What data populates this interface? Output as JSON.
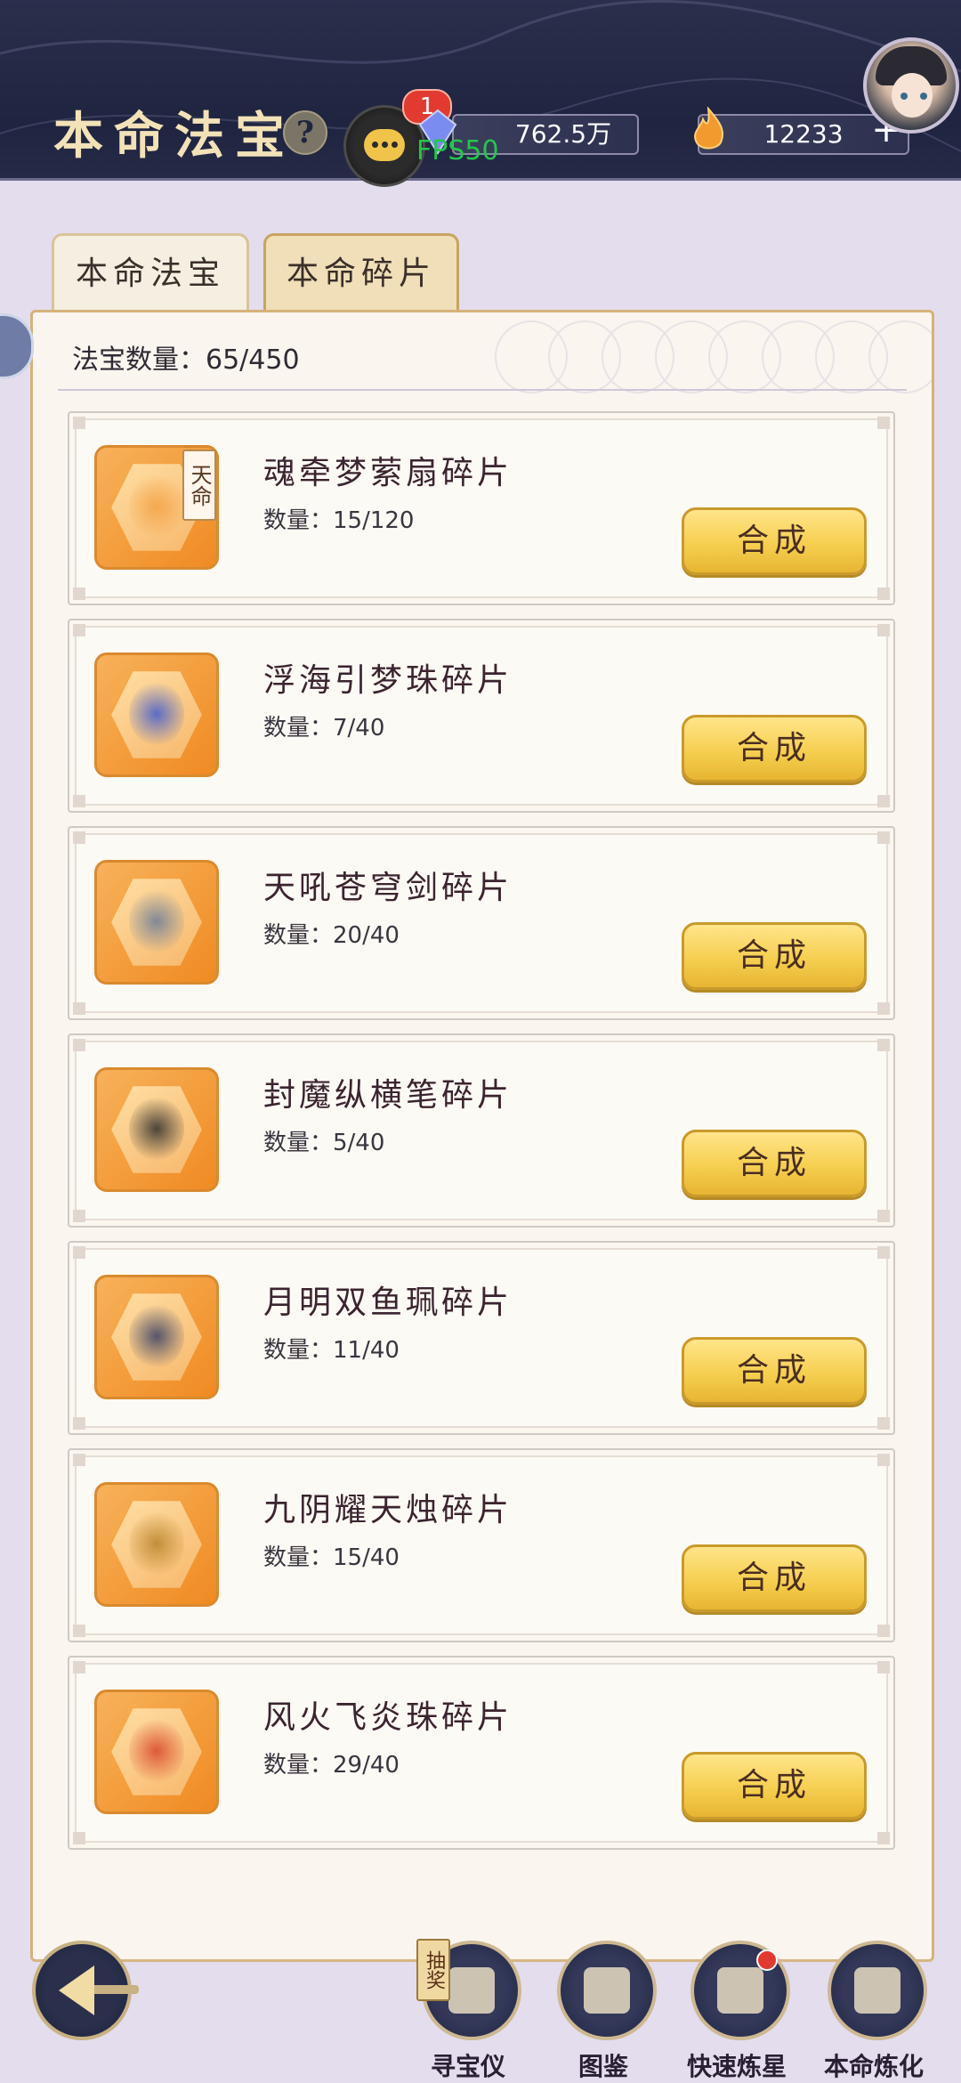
{
  "header": {
    "title": "本命法宝",
    "help_symbol": "?",
    "chat_badge": "1",
    "fps": "FPS50",
    "currency_1": "762.5万",
    "currency_2": "12233",
    "currency_2_add": "+"
  },
  "tabs": [
    {
      "label": "本命法宝",
      "active": false
    },
    {
      "label": "本命碎片",
      "active": true
    }
  ],
  "panel": {
    "count_label": "法宝数量：65/450"
  },
  "items": [
    {
      "name": "魂牵梦萦扇碎片",
      "quantity": "数量：15/120",
      "tag": "天命",
      "button": "合成",
      "color": "#f3a244"
    },
    {
      "name": "浮海引梦珠碎片",
      "quantity": "数量：7/40",
      "tag": "",
      "button": "合成",
      "color": "#3f5bd0"
    },
    {
      "name": "天吼苍穹剑碎片",
      "quantity": "数量：20/40",
      "tag": "",
      "button": "合成",
      "color": "#6b7d9a"
    },
    {
      "name": "封魔纵横笔碎片",
      "quantity": "数量：5/40",
      "tag": "",
      "button": "合成",
      "color": "#2d2d2d"
    },
    {
      "name": "月明双鱼珮碎片",
      "quantity": "数量：11/40",
      "tag": "",
      "button": "合成",
      "color": "#394066"
    },
    {
      "name": "九阴耀天烛碎片",
      "quantity": "数量：15/40",
      "tag": "",
      "button": "合成",
      "color": "#b8842c"
    },
    {
      "name": "风火飞炎珠碎片",
      "quantity": "数量：29/40",
      "tag": "",
      "button": "合成",
      "color": "#d8462a"
    }
  ],
  "bottom_nav": [
    {
      "label": "寻宝仪",
      "icon": "compass-scroll-icon"
    },
    {
      "label": "图鉴",
      "icon": "scroll-icon"
    },
    {
      "label": "快速炼星",
      "icon": "hammer-icon"
    },
    {
      "label": "本命炼化",
      "icon": "cloud-icon"
    }
  ],
  "lottery_tag": "抽奖"
}
